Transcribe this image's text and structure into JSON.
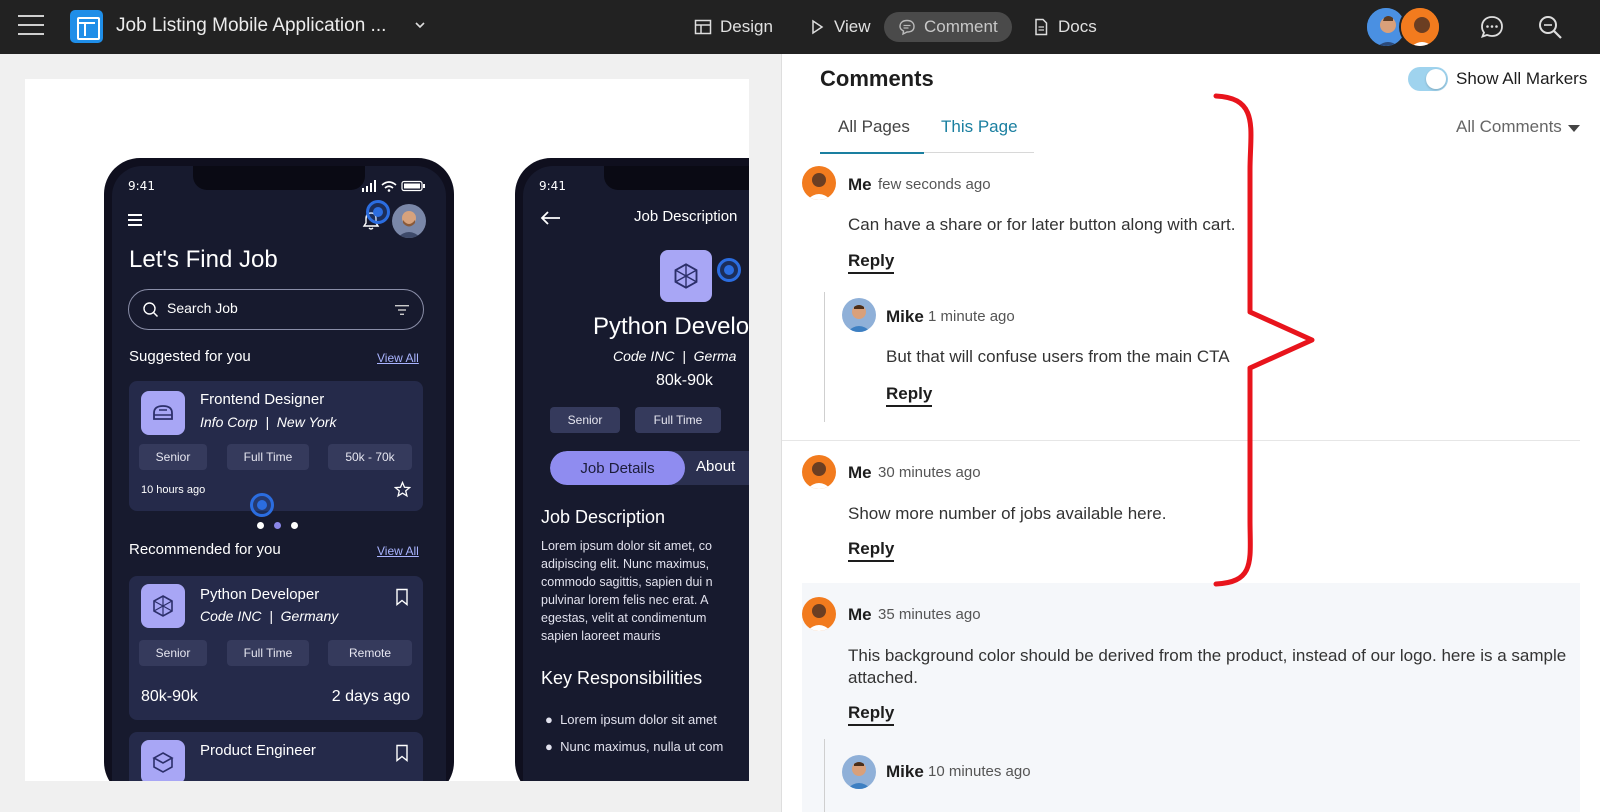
{
  "topbar": {
    "project_title": "Job Listing Mobile Application ...",
    "nav": {
      "design": "Design",
      "view": "View",
      "comment": "Comment",
      "docs": "Docs"
    }
  },
  "phone1": {
    "time": "9:41",
    "heading": "Let's Find Job",
    "search_placeholder": "Search Job",
    "suggested_label": "Suggested for you",
    "view_all": "View All",
    "suggested_card": {
      "title": "Frontend Designer",
      "company": "Info Corp",
      "location": "New York",
      "chips": [
        "Senior",
        "Full Time",
        "50k - 70k"
      ],
      "posted": "10 hours ago"
    },
    "recommended_label": "Recommended for you",
    "recommended_card": {
      "title": "Python Developer",
      "company": "Code INC",
      "location": "Germany",
      "chips": [
        "Senior",
        "Full Time",
        "Remote"
      ],
      "salary": "80k-90k",
      "posted": "2 days ago"
    },
    "third_card_title": "Product Engineer"
  },
  "phone2": {
    "time": "9:41",
    "header": "Job Description",
    "title": "Python Develo",
    "company": "Code INC",
    "location": "Germa",
    "salary": "80k-90k",
    "chips": [
      "Senior",
      "Full Time"
    ],
    "tab_active": "Job Details",
    "tab_other": "About",
    "section_job_desc": "Job Description",
    "desc_lines": [
      "Lorem ipsum dolor sit amet, co",
      "adipiscing elit. Nunc maximus,",
      "commodo sagittis, sapien dui n",
      "pulvinar lorem felis nec erat. A",
      "egestas, velit at condimentum",
      "sapien laoreet mauris"
    ],
    "section_key": "Key Responsibilities",
    "bullets": [
      "Lorem ipsum dolor sit amet",
      "Nunc maximus, nulla ut com"
    ]
  },
  "comments": {
    "title": "Comments",
    "show_markers": "Show All Markers",
    "tab_all": "All Pages",
    "tab_this": "This Page",
    "filter": "All Comments",
    "reply_label": "Reply",
    "threads": [
      {
        "author": "Me",
        "time": "few seconds ago",
        "text": "Can have a share or for later button along with cart."
      },
      {
        "author": "Mike",
        "time": "1 minute ago",
        "text": "But that will confuse users from the main CTA"
      },
      {
        "author": "Me",
        "time": "30 minutes ago",
        "text": "Show more number of jobs available here."
      },
      {
        "author": "Me",
        "time": "35 minutes ago",
        "text_line1": "This background color should be derived from the product, instead of our logo. here is a sample",
        "text_line2": "attached."
      },
      {
        "author": "Mike",
        "time": "10 minutes ago"
      }
    ]
  },
  "colors": {
    "topbar_bg": "#222222",
    "accent_link": "#1a7fa0",
    "annotation_red": "#e8141c",
    "phone_bg": "#171a2e",
    "tile_lavender": "#a8a6f5"
  }
}
